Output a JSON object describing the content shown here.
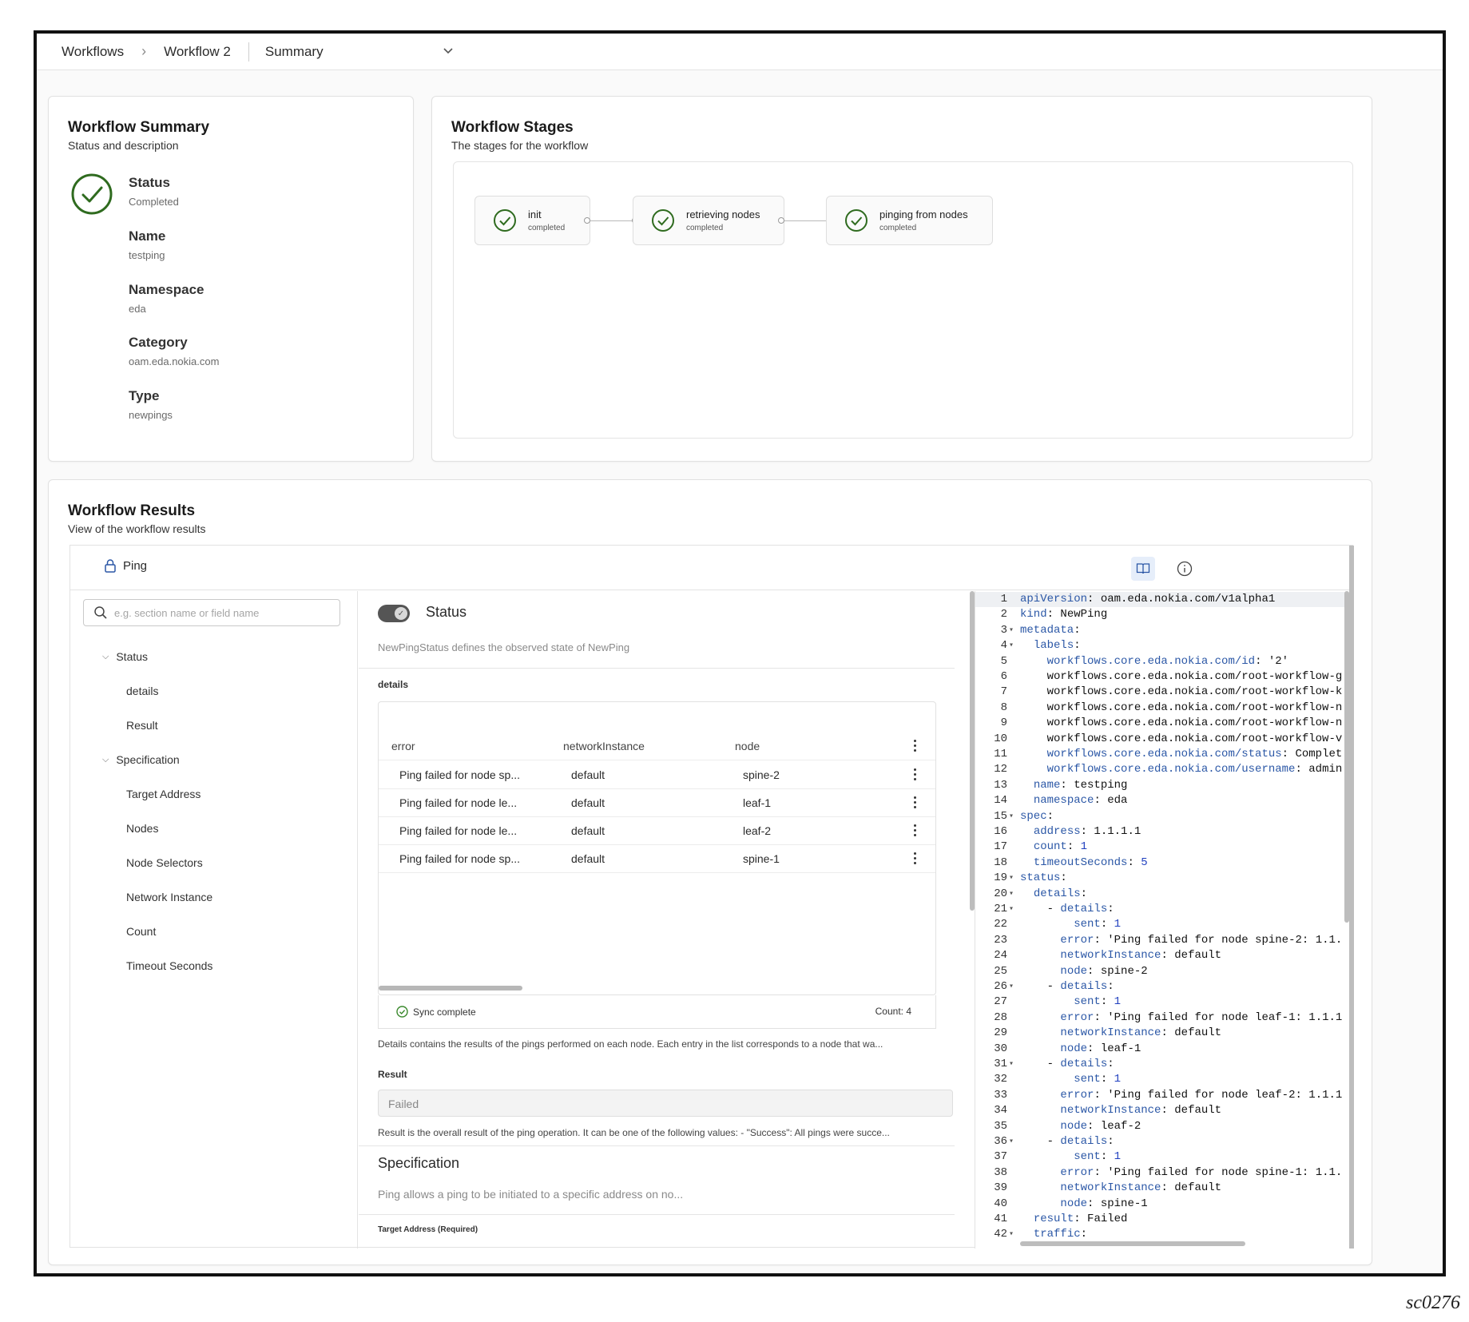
{
  "breadcrumb": {
    "items": [
      "Workflows",
      "Workflow 2"
    ],
    "selected_view": "Summary"
  },
  "summary": {
    "title": "Workflow Summary",
    "subtitle": "Status and description",
    "fields": [
      {
        "label": "Status",
        "value": "Completed"
      },
      {
        "label": "Name",
        "value": "testping"
      },
      {
        "label": "Namespace",
        "value": "eda"
      },
      {
        "label": "Category",
        "value": "oam.eda.nokia.com"
      },
      {
        "label": "Type",
        "value": "newpings"
      }
    ]
  },
  "stages": {
    "title": "Workflow Stages",
    "subtitle": "The stages for the workflow",
    "items": [
      {
        "name": "init",
        "status": "completed"
      },
      {
        "name": "retrieving nodes",
        "status": "completed"
      },
      {
        "name": "pinging from nodes",
        "status": "completed"
      }
    ]
  },
  "results": {
    "title": "Workflow Results",
    "subtitle": "View of the workflow results",
    "resource_label": "Ping",
    "search_placeholder": "e.g. section name or field name",
    "nav": {
      "status_group": "Status",
      "status_items": [
        "details",
        "Result"
      ],
      "spec_group": "Specification",
      "spec_items": [
        "Target Address",
        "Nodes",
        "Node Selectors",
        "Network Instance",
        "Count",
        "Timeout Seconds"
      ]
    },
    "form": {
      "status_title": "Status",
      "status_desc": "NewPingStatus defines the observed state of NewPing",
      "details_label": "details",
      "columns": [
        "error",
        "networkInstance",
        "node"
      ],
      "rows": [
        [
          "Ping failed for node sp...",
          "default",
          "spine-2"
        ],
        [
          "Ping failed for node le...",
          "default",
          "leaf-1"
        ],
        [
          "Ping failed for node le...",
          "default",
          "leaf-2"
        ],
        [
          "Ping failed for node sp...",
          "default",
          "spine-1"
        ]
      ],
      "sync_text": "Sync complete",
      "count_text": "Count: 4",
      "details_help": "Details contains the results of the pings performed on each node. Each entry in the list corresponds to a node that wa...",
      "result_label": "Result",
      "result_value": "Failed",
      "result_help": "Result is the overall result of the ping operation. It can be one of the following values: - \"Success\": All pings were succe...",
      "spec_title": "Specification",
      "spec_desc": "Ping allows a ping to be initiated to a specific address on no...",
      "target_label_partial": "Target Address (Required)"
    },
    "yaml": [
      {
        "n": "1",
        "f": "",
        "t": "apiVersion: oam.eda.nokia.com/v1alpha1"
      },
      {
        "n": "2",
        "f": "",
        "t": "kind: NewPing"
      },
      {
        "n": "3",
        "f": "▾",
        "t": "metadata:"
      },
      {
        "n": "4",
        "f": "▾",
        "t": "  labels:"
      },
      {
        "n": "5",
        "f": "",
        "t": "    workflows.core.eda.nokia.com/id: '2'"
      },
      {
        "n": "6",
        "f": "",
        "t": "    workflows.core.eda.nokia.com/root-workflow-g"
      },
      {
        "n": "7",
        "f": "",
        "t": "    workflows.core.eda.nokia.com/root-workflow-k"
      },
      {
        "n": "8",
        "f": "",
        "t": "    workflows.core.eda.nokia.com/root-workflow-n"
      },
      {
        "n": "9",
        "f": "",
        "t": "    workflows.core.eda.nokia.com/root-workflow-n"
      },
      {
        "n": "10",
        "f": "",
        "t": "    workflows.core.eda.nokia.com/root-workflow-v"
      },
      {
        "n": "11",
        "f": "",
        "t": "    workflows.core.eda.nokia.com/status: Complet"
      },
      {
        "n": "12",
        "f": "",
        "t": "    workflows.core.eda.nokia.com/username: admin"
      },
      {
        "n": "13",
        "f": "",
        "t": "  name: testping"
      },
      {
        "n": "14",
        "f": "",
        "t": "  namespace: eda"
      },
      {
        "n": "15",
        "f": "▾",
        "t": "spec:"
      },
      {
        "n": "16",
        "f": "",
        "t": "  address: 1.1.1.1"
      },
      {
        "n": "17",
        "f": "",
        "t": "  count: 1"
      },
      {
        "n": "18",
        "f": "",
        "t": "  timeoutSeconds: 5"
      },
      {
        "n": "19",
        "f": "▾",
        "t": "status:"
      },
      {
        "n": "20",
        "f": "▾",
        "t": "  details:"
      },
      {
        "n": "21",
        "f": "▾",
        "t": "    - details:"
      },
      {
        "n": "22",
        "f": "",
        "t": "        sent: 1"
      },
      {
        "n": "23",
        "f": "",
        "t": "      error: 'Ping failed for node spine-2: 1.1."
      },
      {
        "n": "24",
        "f": "",
        "t": "      networkInstance: default"
      },
      {
        "n": "25",
        "f": "",
        "t": "      node: spine-2"
      },
      {
        "n": "26",
        "f": "▾",
        "t": "    - details:"
      },
      {
        "n": "27",
        "f": "",
        "t": "        sent: 1"
      },
      {
        "n": "28",
        "f": "",
        "t": "      error: 'Ping failed for node leaf-1: 1.1.1"
      },
      {
        "n": "29",
        "f": "",
        "t": "      networkInstance: default"
      },
      {
        "n": "30",
        "f": "",
        "t": "      node: leaf-1"
      },
      {
        "n": "31",
        "f": "▾",
        "t": "    - details:"
      },
      {
        "n": "32",
        "f": "",
        "t": "        sent: 1"
      },
      {
        "n": "33",
        "f": "",
        "t": "      error: 'Ping failed for node leaf-2: 1.1.1"
      },
      {
        "n": "34",
        "f": "",
        "t": "      networkInstance: default"
      },
      {
        "n": "35",
        "f": "",
        "t": "      node: leaf-2"
      },
      {
        "n": "36",
        "f": "▾",
        "t": "    - details:"
      },
      {
        "n": "37",
        "f": "",
        "t": "        sent: 1"
      },
      {
        "n": "38",
        "f": "",
        "t": "      error: 'Ping failed for node spine-1: 1.1."
      },
      {
        "n": "39",
        "f": "",
        "t": "      networkInstance: default"
      },
      {
        "n": "40",
        "f": "",
        "t": "      node: spine-1"
      },
      {
        "n": "41",
        "f": "",
        "t": "  result: Failed"
      },
      {
        "n": "42",
        "f": "▾",
        "t": "  traffic:"
      }
    ]
  },
  "figure_id": "sc0276",
  "colors": {
    "success": "#2f6b1f",
    "accent": "#2b57a6"
  }
}
